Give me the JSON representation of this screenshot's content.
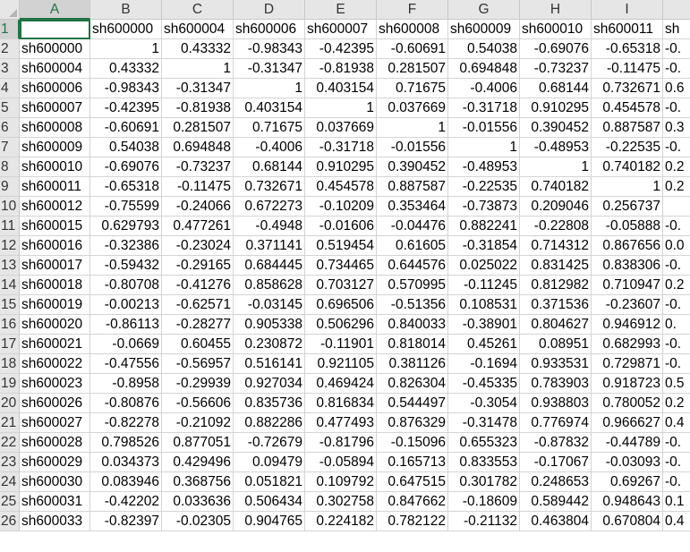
{
  "columns": [
    "A",
    "B",
    "C",
    "D",
    "E",
    "F",
    "G",
    "H",
    "I",
    ""
  ],
  "active_column": "A",
  "active_row": "1",
  "rows": [
    {
      "n": "1",
      "cells": [
        "",
        "sh600000",
        "sh600004",
        "sh600006",
        "sh600007",
        "sh600008",
        "sh600009",
        "sh600010",
        "sh600011",
        "sh"
      ]
    },
    {
      "n": "2",
      "cells": [
        "sh600000",
        "1",
        "0.43332",
        "-0.98343",
        "-0.42395",
        "-0.60691",
        "0.54038",
        "-0.69076",
        "-0.65318",
        "-0."
      ]
    },
    {
      "n": "3",
      "cells": [
        "sh600004",
        "0.43332",
        "1",
        "-0.31347",
        "-0.81938",
        "0.281507",
        "0.694848",
        "-0.73237",
        "-0.11475",
        "-0."
      ]
    },
    {
      "n": "4",
      "cells": [
        "sh600006",
        "-0.98343",
        "-0.31347",
        "1",
        "0.403154",
        "0.71675",
        "-0.4006",
        "0.68144",
        "0.732671",
        "0.6"
      ]
    },
    {
      "n": "5",
      "cells": [
        "sh600007",
        "-0.42395",
        "-0.81938",
        "0.403154",
        "1",
        "0.037669",
        "-0.31718",
        "0.910295",
        "0.454578",
        "-0."
      ]
    },
    {
      "n": "6",
      "cells": [
        "sh600008",
        "-0.60691",
        "0.281507",
        "0.71675",
        "0.037669",
        "1",
        "-0.01556",
        "0.390452",
        "0.887587",
        "0.3"
      ]
    },
    {
      "n": "7",
      "cells": [
        "sh600009",
        "0.54038",
        "0.694848",
        "-0.4006",
        "-0.31718",
        "-0.01556",
        "1",
        "-0.48953",
        "-0.22535",
        "-0."
      ]
    },
    {
      "n": "8",
      "cells": [
        "sh600010",
        "-0.69076",
        "-0.73237",
        "0.68144",
        "0.910295",
        "0.390452",
        "-0.48953",
        "1",
        "0.740182",
        "0.2"
      ]
    },
    {
      "n": "9",
      "cells": [
        "sh600011",
        "-0.65318",
        "-0.11475",
        "0.732671",
        "0.454578",
        "0.887587",
        "-0.22535",
        "0.740182",
        "1",
        "0.2"
      ]
    },
    {
      "n": "10",
      "cells": [
        "sh600012",
        "-0.75599",
        "-0.24066",
        "0.672273",
        "-0.10209",
        "0.353464",
        "-0.73873",
        "0.209046",
        "0.256737",
        ""
      ]
    },
    {
      "n": "11",
      "cells": [
        "sh600015",
        "0.629793",
        "0.477261",
        "-0.4948",
        "-0.01606",
        "-0.04476",
        "0.882241",
        "-0.22808",
        "-0.05888",
        "-0."
      ]
    },
    {
      "n": "12",
      "cells": [
        "sh600016",
        "-0.32386",
        "-0.23024",
        "0.371141",
        "0.519454",
        "0.61605",
        "-0.31854",
        "0.714312",
        "0.867656",
        "0.0"
      ]
    },
    {
      "n": "13",
      "cells": [
        "sh600017",
        "-0.59432",
        "-0.29165",
        "0.684445",
        "0.734465",
        "0.644576",
        "0.025022",
        "0.831425",
        "0.838306",
        "-0."
      ]
    },
    {
      "n": "14",
      "cells": [
        "sh600018",
        "-0.80708",
        "-0.41276",
        "0.858628",
        "0.703127",
        "0.570995",
        "-0.11245",
        "0.812982",
        "0.710947",
        "0.2"
      ]
    },
    {
      "n": "15",
      "cells": [
        "sh600019",
        "-0.00213",
        "-0.62571",
        "-0.03145",
        "0.696506",
        "-0.51356",
        "0.108531",
        "0.371536",
        "-0.23607",
        "-0."
      ]
    },
    {
      "n": "16",
      "cells": [
        "sh600020",
        "-0.86113",
        "-0.28277",
        "0.905338",
        "0.506296",
        "0.840033",
        "-0.38901",
        "0.804627",
        "0.946912",
        "0."
      ]
    },
    {
      "n": "17",
      "cells": [
        "sh600021",
        "-0.0669",
        "0.60455",
        "0.230872",
        "-0.11901",
        "0.818014",
        "0.45261",
        "0.08951",
        "0.682993",
        "-0."
      ]
    },
    {
      "n": "18",
      "cells": [
        "sh600022",
        "-0.47556",
        "-0.56957",
        "0.516141",
        "0.921105",
        "0.381126",
        "-0.1694",
        "0.933531",
        "0.729871",
        "-0."
      ]
    },
    {
      "n": "19",
      "cells": [
        "sh600023",
        "-0.8958",
        "-0.29939",
        "0.927034",
        "0.469424",
        "0.826304",
        "-0.45335",
        "0.783903",
        "0.918723",
        "0.5"
      ]
    },
    {
      "n": "20",
      "cells": [
        "sh600026",
        "-0.80876",
        "-0.56606",
        "0.835736",
        "0.816834",
        "0.544497",
        "-0.3054",
        "0.938803",
        "0.780052",
        "0.2"
      ]
    },
    {
      "n": "21",
      "cells": [
        "sh600027",
        "-0.82278",
        "-0.21092",
        "0.882286",
        "0.477493",
        "0.876329",
        "-0.31478",
        "0.776974",
        "0.966627",
        "0.4"
      ]
    },
    {
      "n": "22",
      "cells": [
        "sh600028",
        "0.798526",
        "0.877051",
        "-0.72679",
        "-0.81796",
        "-0.15096",
        "0.655323",
        "-0.87832",
        "-0.44789",
        "-0."
      ]
    },
    {
      "n": "23",
      "cells": [
        "sh600029",
        "0.034373",
        "0.429496",
        "0.09479",
        "-0.05894",
        "0.165713",
        "0.833553",
        "-0.17067",
        "-0.03093",
        "-0."
      ]
    },
    {
      "n": "24",
      "cells": [
        "sh600030",
        "0.083946",
        "0.368756",
        "0.051821",
        "0.109792",
        "0.647515",
        "0.301782",
        "0.248653",
        "0.69267",
        "-0."
      ]
    },
    {
      "n": "25",
      "cells": [
        "sh600031",
        "-0.42202",
        "0.033636",
        "0.506434",
        "0.302758",
        "0.847662",
        "-0.18609",
        "0.589442",
        "0.948643",
        "0.1"
      ]
    },
    {
      "n": "26",
      "cells": [
        "sh600033",
        "-0.82397",
        "-0.02305",
        "0.904765",
        "0.224182",
        "0.782122",
        "-0.21132",
        "0.463804",
        "0.670804",
        "0.4"
      ]
    }
  ]
}
